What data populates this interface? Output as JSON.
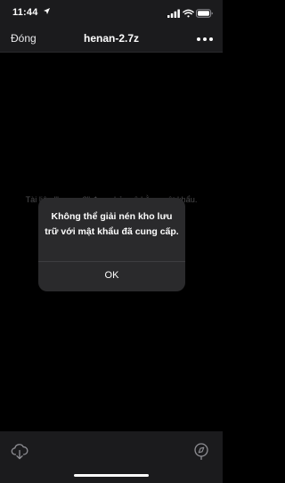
{
  "status_bar": {
    "time": "11:44",
    "location_icon": "location-arrow-icon",
    "signal_icon": "cellular-signal-icon",
    "wifi_icon": "wifi-icon",
    "battery_icon": "battery-icon"
  },
  "nav": {
    "back_label": "Đóng",
    "title": "henan-2.7z",
    "more_icon": "more-ellipsis-icon"
  },
  "content": {
    "protected_message": "Tài liệu \"henan-2\" được bảo vệ bằng mật khẩu."
  },
  "alert": {
    "title": "Không thể giải nén kho lưu trữ với mật khẩu đã cung cấp.",
    "ok_label": "OK"
  },
  "toolbar": {
    "download_icon": "cloud-download-icon",
    "compass_icon": "compass-icon"
  },
  "colors": {
    "background": "#000000",
    "bars": "#1b1b1d",
    "alert_background": "#2a2a2c",
    "dim_text": "#4a4a4c"
  }
}
